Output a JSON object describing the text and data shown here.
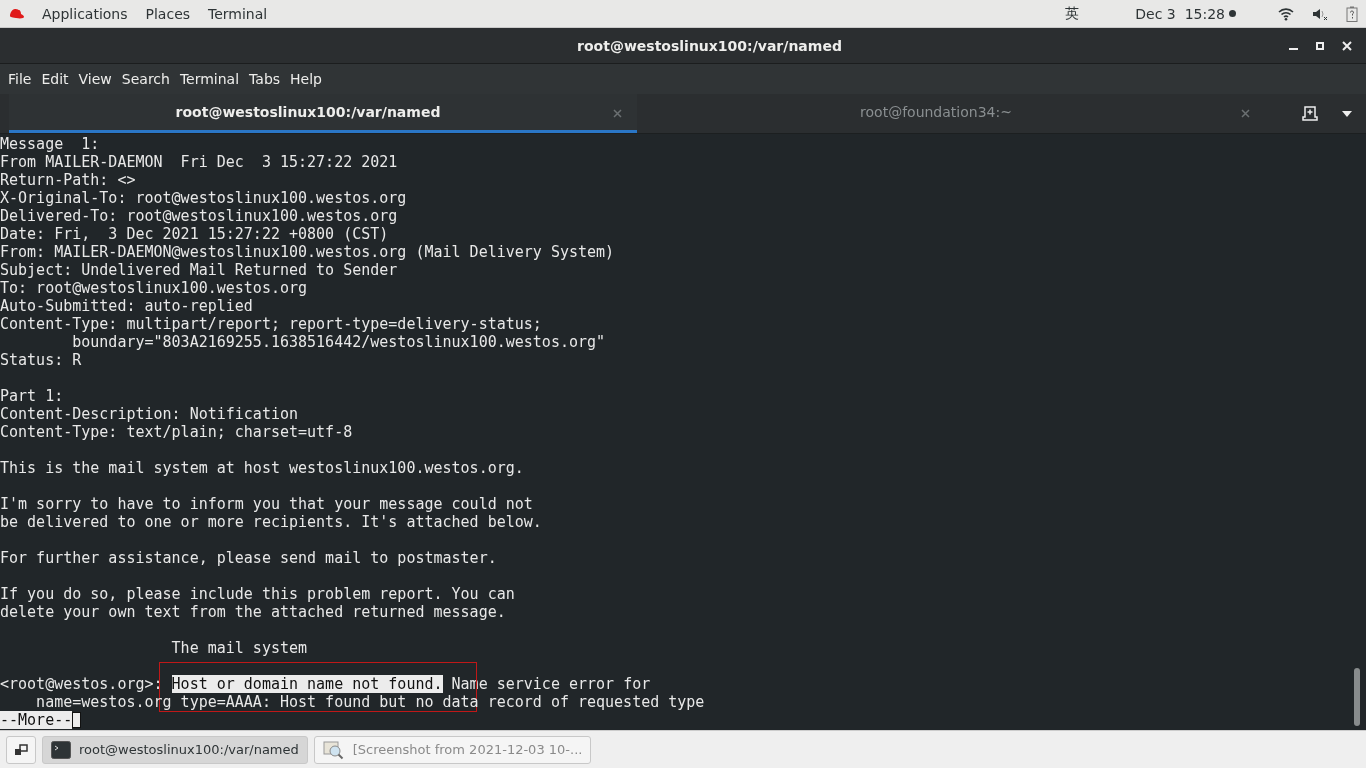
{
  "top_bar": {
    "menus": [
      "Applications",
      "Places",
      "Terminal"
    ],
    "input_method": "英",
    "clock": "Dec 3  15:28"
  },
  "window": {
    "title": "root@westoslinux100:/var/named"
  },
  "menu_bar": [
    "File",
    "Edit",
    "View",
    "Search",
    "Terminal",
    "Tabs",
    "Help"
  ],
  "tabs": [
    {
      "label": "root@westoslinux100:/var/named",
      "selected": true
    },
    {
      "label": "root@foundation34:~",
      "selected": false
    }
  ],
  "terminal": {
    "lines": [
      {
        "kind": "text",
        "text": "Message  1:"
      },
      {
        "kind": "text",
        "text": "From MAILER-DAEMON  Fri Dec  3 15:27:22 2021"
      },
      {
        "kind": "text",
        "text": "Return-Path: <>"
      },
      {
        "kind": "text",
        "text": "X-Original-To: root@westoslinux100.westos.org"
      },
      {
        "kind": "text",
        "text": "Delivered-To: root@westoslinux100.westos.org"
      },
      {
        "kind": "text",
        "text": "Date: Fri,  3 Dec 2021 15:27:22 +0800 (CST)"
      },
      {
        "kind": "text",
        "text": "From: MAILER-DAEMON@westoslinux100.westos.org (Mail Delivery System)"
      },
      {
        "kind": "text",
        "text": "Subject: Undelivered Mail Returned to Sender"
      },
      {
        "kind": "text",
        "text": "To: root@westoslinux100.westos.org"
      },
      {
        "kind": "text",
        "text": "Auto-Submitted: auto-replied"
      },
      {
        "kind": "text",
        "text": "Content-Type: multipart/report; report-type=delivery-status;"
      },
      {
        "kind": "text",
        "text": "        boundary=\"803A2169255.1638516442/westoslinux100.westos.org\""
      },
      {
        "kind": "text",
        "text": "Status: R"
      },
      {
        "kind": "blank"
      },
      {
        "kind": "text",
        "text": "Part 1:"
      },
      {
        "kind": "text",
        "text": "Content-Description: Notification"
      },
      {
        "kind": "text",
        "text": "Content-Type: text/plain; charset=utf-8"
      },
      {
        "kind": "blank"
      },
      {
        "kind": "text",
        "text": "This is the mail system at host westoslinux100.westos.org."
      },
      {
        "kind": "blank"
      },
      {
        "kind": "text",
        "text": "I'm sorry to have to inform you that your message could not"
      },
      {
        "kind": "text",
        "text": "be delivered to one or more recipients. It's attached below."
      },
      {
        "kind": "blank"
      },
      {
        "kind": "text",
        "text": "For further assistance, please send mail to postmaster."
      },
      {
        "kind": "blank"
      },
      {
        "kind": "text",
        "text": "If you do so, please include this problem report. You can"
      },
      {
        "kind": "text",
        "text": "delete your own text from the attached returned message."
      },
      {
        "kind": "blank"
      },
      {
        "kind": "text",
        "text": "                   The mail system"
      },
      {
        "kind": "blank"
      },
      {
        "kind": "split",
        "boxed": true,
        "parts": [
          {
            "text": "<root@westos.org>: ",
            "selected": false
          },
          {
            "text": "Host or domain name not found.",
            "selected": true
          },
          {
            "text": " Name service error for",
            "selected": false
          }
        ]
      },
      {
        "kind": "text",
        "text": "    name=westos.org type=AAAA: Host found but no data record of requested type"
      },
      {
        "kind": "prompt",
        "text": "--More--"
      }
    ]
  },
  "taskbar": [
    {
      "label": "root@westoslinux100:/var/named",
      "kind": "terminal",
      "selected": true
    },
    {
      "label": "[Screenshot from 2021-12-03 10-...",
      "kind": "image-viewer",
      "selected": false
    }
  ]
}
